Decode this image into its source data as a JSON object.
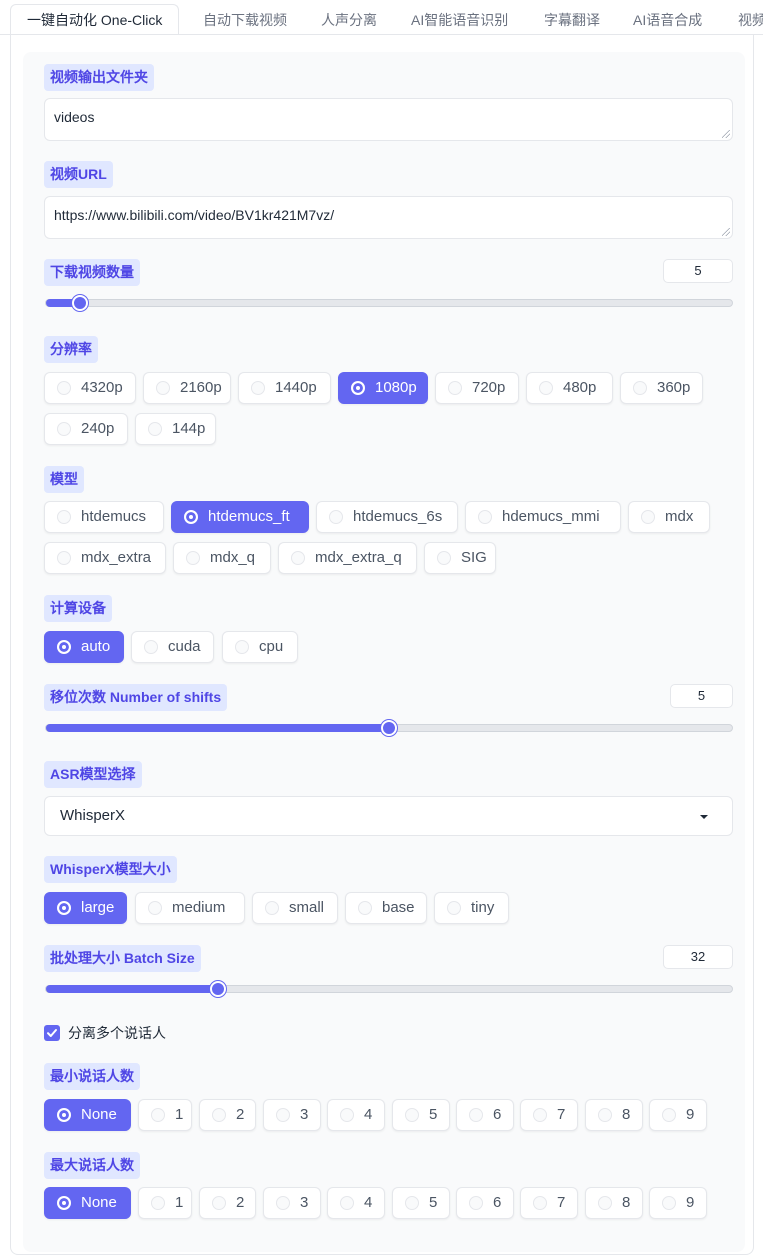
{
  "tabs": [
    "一键自动化 One-Click",
    "自动下载视频",
    "人声分离",
    "AI智能语音识别",
    "字幕翻译",
    "AI语音合成",
    "视频"
  ],
  "video_folder": {
    "label": "视频输出文件夹",
    "value": "videos"
  },
  "video_url": {
    "label": "视频URL",
    "value": "https://www.bilibili.com/video/BV1kr421M7vz/"
  },
  "download_count": {
    "label": "下载视频数量",
    "value": "5",
    "fraction": 0.05
  },
  "resolution": {
    "label": "分辨率",
    "options": [
      "4320p",
      "2160p",
      "1440p",
      "1080p",
      "720p",
      "480p",
      "360p",
      "240p",
      "144p"
    ],
    "selected": "1080p"
  },
  "model": {
    "label": "模型",
    "options": [
      "htdemucs",
      "htdemucs_ft",
      "htdemucs_6s",
      "hdemucs_mmi",
      "mdx",
      "mdx_extra",
      "mdx_q",
      "mdx_extra_q",
      "SIG"
    ],
    "selected": "htdemucs_ft"
  },
  "device": {
    "label": "计算设备",
    "options": [
      "auto",
      "cuda",
      "cpu"
    ],
    "selected": "auto"
  },
  "shifts": {
    "label": "移位次数 Number of shifts",
    "value": "5",
    "fraction": 0.5
  },
  "asr": {
    "label": "ASR模型选择",
    "value": "WhisperX"
  },
  "whisper_size": {
    "label": "WhisperX模型大小",
    "options": [
      "large",
      "medium",
      "small",
      "base",
      "tiny"
    ],
    "selected": "large"
  },
  "batch_size": {
    "label": "批处理大小 Batch Size",
    "value": "32",
    "fraction": 0.25
  },
  "diarize": {
    "label": "分离多个说话人",
    "checked": true
  },
  "min_speakers": {
    "label": "最小说话人数",
    "options": [
      "None",
      "1",
      "2",
      "3",
      "4",
      "5",
      "6",
      "7",
      "8",
      "9"
    ],
    "selected": "None"
  },
  "max_speakers": {
    "label": "最大说话人数",
    "options": [
      "None",
      "1",
      "2",
      "3",
      "4",
      "5",
      "6",
      "7",
      "8",
      "9"
    ],
    "selected": "None"
  },
  "colors": {
    "accent": "#6366f1",
    "label_bg": "#e0e7ff",
    "label_text": "#4f46e5"
  }
}
